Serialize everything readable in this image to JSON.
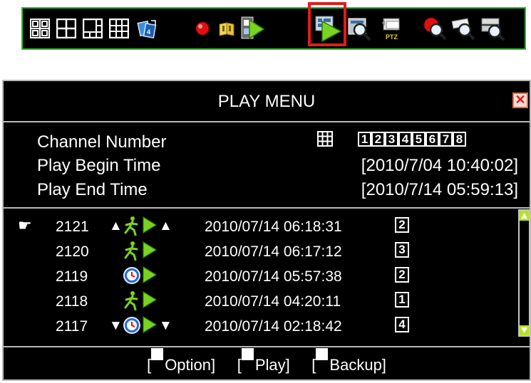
{
  "toolbar": {
    "icons": [
      {
        "name": "split-4-numbered-icon"
      },
      {
        "name": "split-4-icon"
      },
      {
        "name": "split-6-icon"
      },
      {
        "name": "split-9-icon"
      },
      {
        "name": "sequence-icon"
      },
      {
        "name": "record-icon"
      },
      {
        "name": "search-book-icon"
      },
      {
        "name": "playback-icon"
      },
      {
        "name": "play-menu-icon"
      },
      {
        "name": "zoom-icon"
      },
      {
        "name": "ptz-icon",
        "label": "PTZ"
      },
      {
        "name": "record-search-icon"
      },
      {
        "name": "camera-search-icon"
      },
      {
        "name": "network-search-icon"
      }
    ],
    "selected": "play-menu-icon"
  },
  "menu": {
    "title": "PLAY MENU",
    "close_symbol": "✕",
    "channel_label": "Channel Number",
    "channels": [
      "1",
      "2",
      "3",
      "4",
      "5",
      "6",
      "7",
      "8"
    ],
    "begin_label": "Play Begin Time",
    "begin_value": "[2010/7/04 10:40:02]",
    "end_label": "Play End Time",
    "end_value": "[2010/7/14 05:59:13]",
    "cursor_symbol": "☛",
    "records": [
      {
        "id": "2121",
        "datetime": "2010/07/14 06:18:31",
        "channel": "2",
        "type": "motion",
        "up": "▲",
        "down": "▲"
      },
      {
        "id": "2120",
        "datetime": "2010/07/14 06:17:12",
        "channel": "3",
        "type": "motion"
      },
      {
        "id": "2119",
        "datetime": "2010/07/14 05:57:38",
        "channel": "2",
        "type": "schedule"
      },
      {
        "id": "2118",
        "datetime": "2010/07/14 04:20:11",
        "channel": "1",
        "type": "motion"
      },
      {
        "id": "2117",
        "datetime": "2010/07/14 02:18:42",
        "channel": "4",
        "type": "schedule",
        "up": "▼",
        "down": "▼"
      }
    ],
    "footer": {
      "option_label": "Option]",
      "play_label": "Play]",
      "backup_label": "Backup]",
      "open_bracket": "["
    }
  },
  "colors": {
    "toolbar_border": "#22c322",
    "highlight": "#e01b1b",
    "scroll_arrow": "#b7e21c",
    "play_green": "#7bd321"
  }
}
